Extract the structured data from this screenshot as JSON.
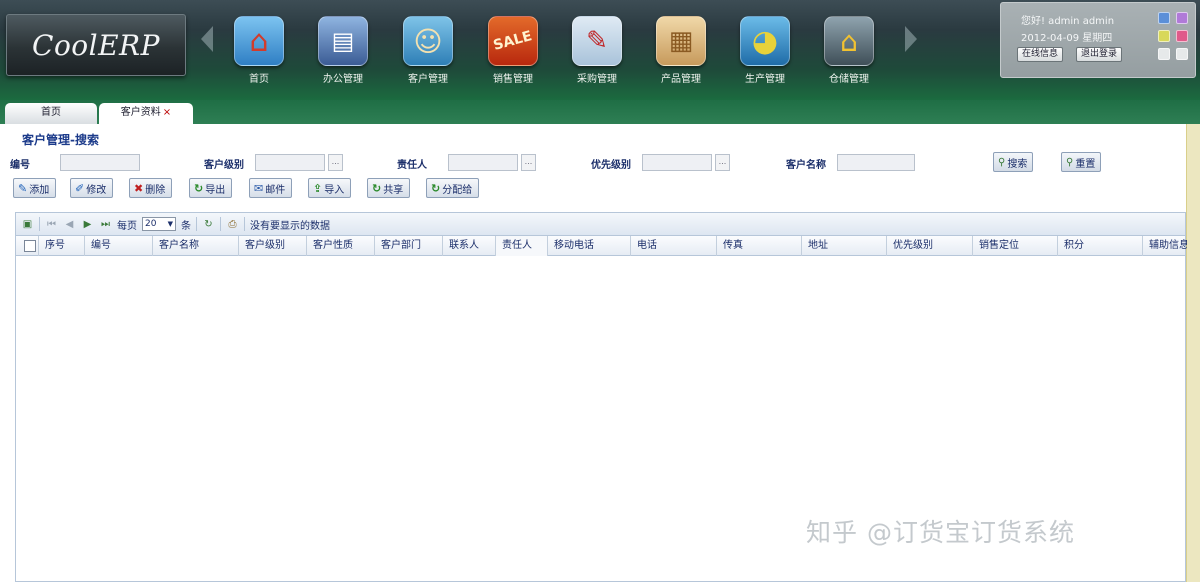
{
  "app": {
    "logo": "CoolERP"
  },
  "nav": [
    {
      "label": "首页",
      "icon": "home-icon",
      "glyph": "⌂",
      "color": "#3a8fd8"
    },
    {
      "label": "办公管理",
      "icon": "office-icon",
      "glyph": "▤",
      "color": "#4b6fa8"
    },
    {
      "label": "客户管理",
      "icon": "customer-icon",
      "glyph": "☺",
      "color": "#3c8a4a"
    },
    {
      "label": "销售管理",
      "icon": "sale-icon",
      "glyph": "SALE",
      "color": "#c43a12"
    },
    {
      "label": "采购管理",
      "icon": "purchase-icon",
      "glyph": "✎",
      "color": "#d4e2ee"
    },
    {
      "label": "产品管理",
      "icon": "product-icon",
      "glyph": "▦",
      "color": "#d9b47a"
    },
    {
      "label": "生产管理",
      "icon": "production-icon",
      "glyph": "◕",
      "color": "#2d8cc8"
    },
    {
      "label": "仓储管理",
      "icon": "warehouse-icon",
      "glyph": "⌂",
      "color": "#5a6b74"
    }
  ],
  "user_panel": {
    "user_line": "您好! admin admin",
    "date_line": "2012-04-09 星期四",
    "online_label": "在线信息",
    "logout_label": "退出登录"
  },
  "tabs": [
    {
      "label": "首页"
    },
    {
      "label": "客户资料",
      "close": "×"
    }
  ],
  "page_title": "客户管理-搜索",
  "search": {
    "fields": [
      {
        "label": "编号",
        "value": ""
      },
      {
        "label": "客户级别",
        "value": ""
      },
      {
        "label": "责任人",
        "value": ""
      },
      {
        "label": "优先级别",
        "value": ""
      },
      {
        "label": "客户名称",
        "value": ""
      }
    ],
    "pick": "...",
    "search_label": "搜索",
    "reset_label": "重置"
  },
  "actions": [
    {
      "label": "添加",
      "glyph": "✎",
      "color": "#1b5fb8"
    },
    {
      "label": "修改",
      "glyph": "✐",
      "color": "#1b5fb8"
    },
    {
      "label": "删除",
      "glyph": "✖",
      "color": "#c02020"
    },
    {
      "label": "导出",
      "glyph": "↻",
      "color": "#2a8a2a"
    },
    {
      "label": "邮件",
      "glyph": "✉",
      "color": "#2a5aa8"
    },
    {
      "label": "导入",
      "glyph": "⇪",
      "color": "#2a8a2a"
    },
    {
      "label": "共享",
      "glyph": "↻",
      "color": "#2a8a2a"
    },
    {
      "label": "分配给",
      "glyph": "↻",
      "color": "#2a8a2a"
    }
  ],
  "grid": {
    "pager": {
      "page_size_label": "每页",
      "page_size": "20",
      "page_unit": "条",
      "status_text": "没有要显示的数据"
    },
    "columns": [
      "序号",
      "编号",
      "客户名称",
      "客户级别",
      "客户性质",
      "客户部门",
      "联系人",
      "责任人",
      "移动电话",
      "电话",
      "传真",
      "地址",
      "优先级别",
      "销售定位",
      "积分",
      "辅助信息"
    ],
    "rows": []
  },
  "watermark": "知乎 @订货宝订货系统"
}
